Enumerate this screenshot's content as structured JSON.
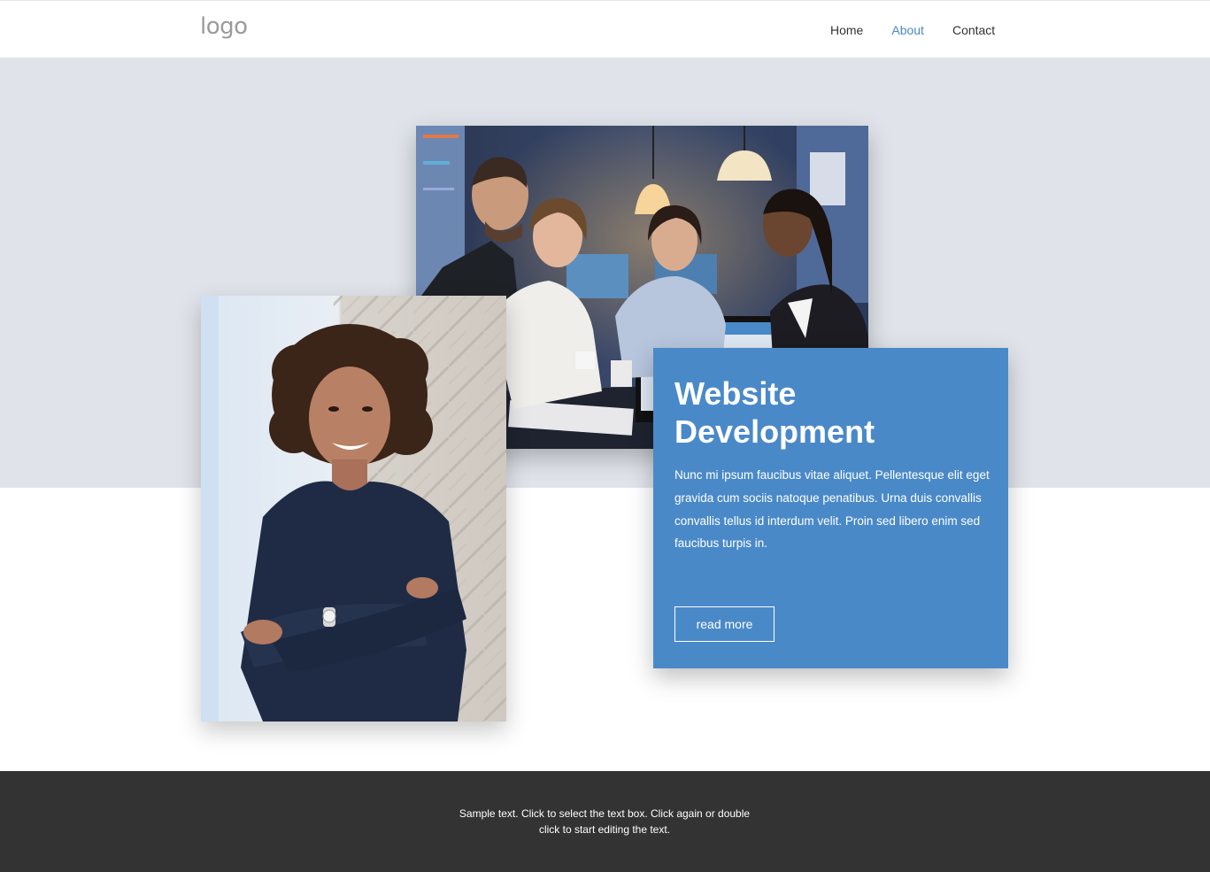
{
  "header": {
    "logo": "logo",
    "nav": [
      {
        "label": "Home"
      },
      {
        "label": "About"
      },
      {
        "label": "Contact"
      }
    ]
  },
  "card": {
    "title_line1": "Website",
    "title_line2": "Development",
    "text": "Nunc mi ipsum faucibus vitae aliquet. Pellentesque elit eget gravida cum sociis natoque penatibus. Urna duis convallis convallis tellus id interdum velit. Proin sed libero enim sed faucibus turpis in.",
    "button": "read more"
  },
  "footer": {
    "text": "Sample text. Click to select the text box. Click again or double click to start editing the text."
  },
  "colors": {
    "accent": "#4a89c8",
    "active_nav": "#4a88c7",
    "band": "#e0e4ea",
    "footer": "#333333"
  }
}
